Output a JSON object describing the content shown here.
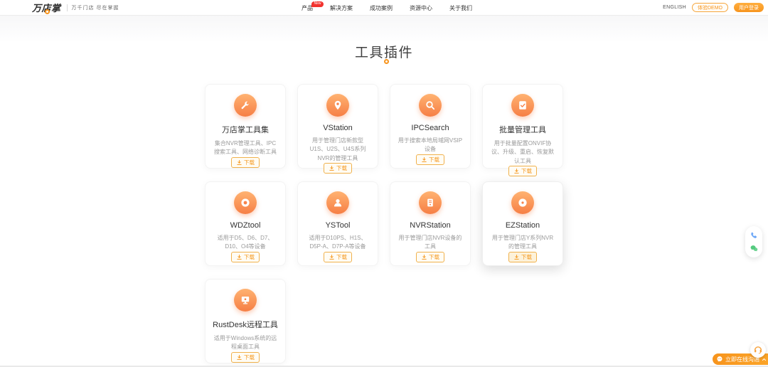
{
  "header": {
    "logo_text": "万店掌",
    "tagline": "万千门店 尽在掌握",
    "nav": [
      {
        "label": "产品",
        "badge": "New"
      },
      {
        "label": "解决方案",
        "badge": ""
      },
      {
        "label": "成功案例",
        "badge": ""
      },
      {
        "label": "资源中心",
        "badge": ""
      },
      {
        "label": "关于我们",
        "badge": ""
      }
    ],
    "language": "ENGLISH",
    "demo_button": "体验DEMO",
    "login_button": "用户登录"
  },
  "main": {
    "title": "工具插件",
    "download_label": "下载",
    "cards": [
      {
        "icon": "wrench-icon",
        "title": "万店掌工具集",
        "desc": "集合NVR管理工具、IPC搜索工具、网络诊断工具",
        "highlighted": false
      },
      {
        "icon": "location-camera-icon",
        "title": "VStation",
        "desc": "用于管理门店新款型U1S、U2S、U4S系列NVR的管理工具",
        "highlighted": false
      },
      {
        "icon": "search-icon",
        "title": "IPCSearch",
        "desc": "用于搜索本地局域网VSIP设备",
        "highlighted": false
      },
      {
        "icon": "checklist-icon",
        "title": "批量管理工具",
        "desc": "用于批量配置ONVIF协议、升级、重启、恢复默认工具",
        "highlighted": false
      },
      {
        "icon": "lens-icon",
        "title": "WDZtool",
        "desc": "适用于D5、D6、D7、D10、O4等设备",
        "highlighted": false
      },
      {
        "icon": "person-icon",
        "title": "YSTool",
        "desc": "适用于D10PS、H1S、D5P-A、D7P-A等设备",
        "highlighted": false
      },
      {
        "icon": "nvr-device-icon",
        "title": "NVRStation",
        "desc": "用于管理门店NVR设备的工具",
        "highlighted": false
      },
      {
        "icon": "disc-icon",
        "title": "EZStation",
        "desc": "用于管理门店Y系列NVR的管理工具",
        "highlighted": true
      },
      {
        "icon": "monitor-icon",
        "title": "RustDesk远程工具",
        "desc": "适用于Windows系统的远程桌面工具",
        "highlighted": false
      }
    ]
  },
  "floating_contact": {
    "phone_icon": "phone-icon",
    "wechat_icon": "wechat-icon"
  },
  "chat_bar": {
    "label": "立即在线沟通"
  },
  "colors": {
    "accent_orange": "#f7941d",
    "badge_red": "#f2322e",
    "icon_gradient_top": "#ffb271",
    "icon_gradient_bottom": "#f67f45",
    "phone_blue": "#6ea8f7",
    "wechat_green": "#54ca7e"
  }
}
